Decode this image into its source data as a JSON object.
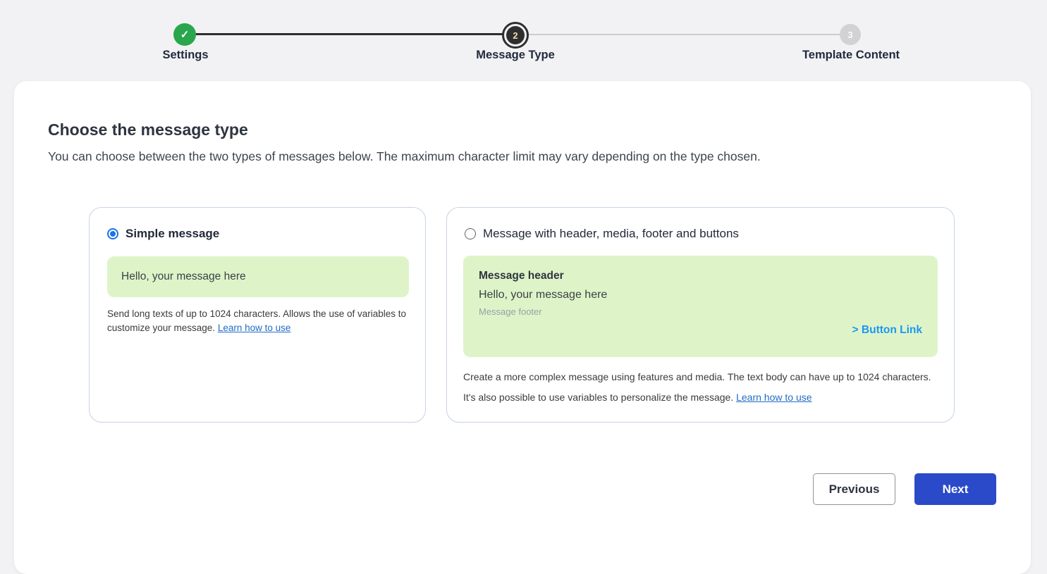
{
  "stepper": {
    "steps": [
      {
        "label": "Settings",
        "state": "completed",
        "check_glyph": "✓"
      },
      {
        "label": "Message Type",
        "state": "current",
        "number": "2"
      },
      {
        "label": "Template Content",
        "state": "upcoming",
        "number": "3"
      }
    ]
  },
  "page": {
    "title": "Choose the message type",
    "subtitle": "You can choose between the two types of messages below. The maximum character limit may vary depending on the type chosen."
  },
  "options": {
    "simple": {
      "label": "Simple message",
      "selected": true,
      "preview_text": "Hello, your message here",
      "description": "Send long texts of up to 1024 characters. Allows the use of variables to customize your message.",
      "link_label": "Learn how to use"
    },
    "complex": {
      "label": "Message with header, media, footer and buttons",
      "selected": false,
      "preview": {
        "header": "Message header",
        "body": "Hello, your message here",
        "footer": "Message footer",
        "button": "> Button Link"
      },
      "description": "Create a more complex message using features and media. The text body can have up to 1024 characters. It's also possible to use variables to personalize the message.",
      "link_label": "Learn how to use"
    }
  },
  "footer": {
    "previous_label": "Previous",
    "next_label": "Next"
  },
  "colors": {
    "success_green": "#2aa64d",
    "current_step_dark": "#2e2e2e",
    "upcoming_gray": "#d2d2d2",
    "preview_green": "#def4c8",
    "radio_blue": "#1a73e8",
    "link_blue": "#1f6cc5",
    "button_link_blue": "#1b97f3",
    "next_button_blue": "#2b4ac9"
  }
}
